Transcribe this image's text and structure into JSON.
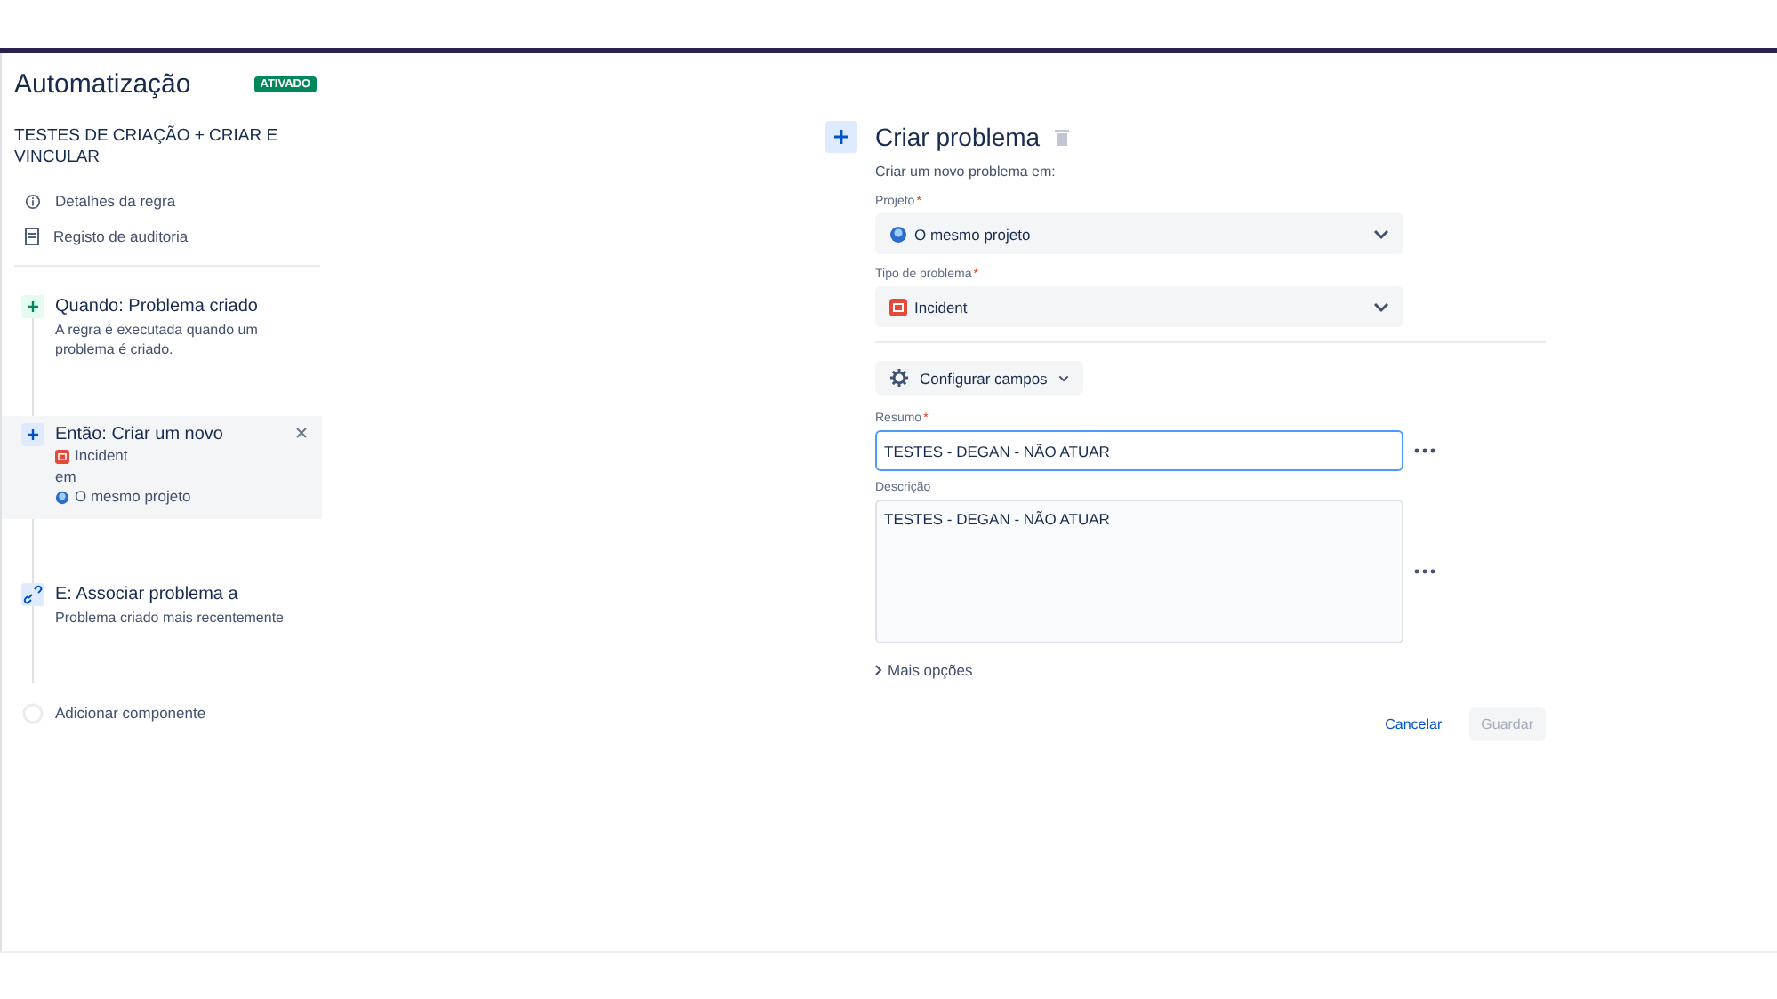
{
  "header": {
    "title": "Automatização",
    "status": "ATIVADO"
  },
  "rule_name": "TESTES DE CRIAÇÃO + CRIAR E VINCULAR",
  "nav": [
    {
      "kind": "info",
      "label": "Detalhes da regra"
    },
    {
      "kind": "audit",
      "label": "Registo de auditoria"
    }
  ],
  "steps": [
    {
      "kind": "trigger",
      "title": "Quando: Problema criado",
      "description": "A regra é executada quando um problema é criado.",
      "selected": false
    },
    {
      "kind": "action",
      "title": "Então: Criar um novo",
      "selected": true,
      "lines": [
        {
          "kind": "issue-type",
          "text": "Incident"
        },
        {
          "kind": "plain",
          "text": "em"
        },
        {
          "kind": "project",
          "text": "O mesmo projeto"
        }
      ]
    },
    {
      "kind": "branch",
      "title": "E: Associar problema a",
      "description": "Problema criado mais recentemente",
      "selected": false
    },
    {
      "kind": "add",
      "title": "Adicionar componente",
      "selected": false
    }
  ],
  "editor": {
    "title": "Criar problema",
    "intro": "Criar um novo problema em:",
    "selects": [
      {
        "label": "Projeto",
        "required_mark": "*",
        "kind": "project",
        "value": "O mesmo projeto"
      },
      {
        "label": "Tipo de problema",
        "required_mark": "*",
        "kind": "issue-type",
        "value": "Incident"
      }
    ],
    "configure_button": "Configurar campos",
    "fields": [
      {
        "kind": "input",
        "label": "Resumo",
        "required_mark": "*",
        "value": "TESTES - DEGAN - NÃO ATUAR",
        "focused": true
      },
      {
        "kind": "textarea",
        "label": "Descrição",
        "value": "TESTES - DEGAN - NÃO ATUAR",
        "focused": false
      }
    ],
    "more_options": "Mais opções",
    "buttons": [
      {
        "kind": "link",
        "label": "Cancelar",
        "disabled": false
      },
      {
        "kind": "primary",
        "label": "Guardar",
        "disabled": true
      }
    ]
  }
}
